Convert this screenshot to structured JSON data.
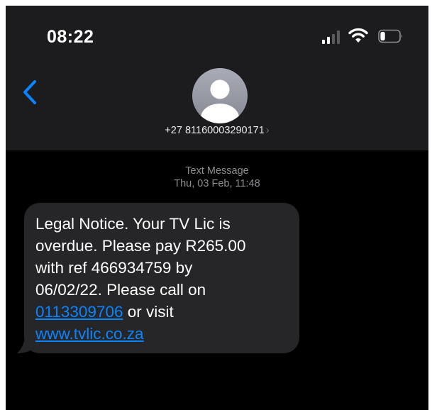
{
  "status_bar": {
    "time": "08:22",
    "signal_icon": "cellular-signal-icon",
    "wifi_icon": "wifi-icon",
    "battery_icon": "battery-icon",
    "battery_level": 0.25
  },
  "header": {
    "back_icon": "chevron-left-icon",
    "avatar_icon": "person-icon",
    "contact_number": "+27 81160003290171",
    "contact_chevron": "›"
  },
  "conversation": {
    "service": "Text Message",
    "timestamp": "Thu, 03 Feb, 11:48"
  },
  "message": {
    "line1": "Legal Notice. Your TV Lic is",
    "line2": "overdue. Please pay R265.00",
    "line3": "with ref 466934759 by",
    "line4": "06/02/22. Please call on",
    "phone_link": "0113309706",
    "line5_suffix": " or visit",
    "url_link": "www.tvlic.co.za"
  },
  "colors": {
    "background": "#000000",
    "header_bg": "#1c1c1e",
    "bubble_bg": "#262628",
    "link": "#0a84ff",
    "accent": "#0a84ff",
    "secondary_text": "#8e8e93"
  }
}
